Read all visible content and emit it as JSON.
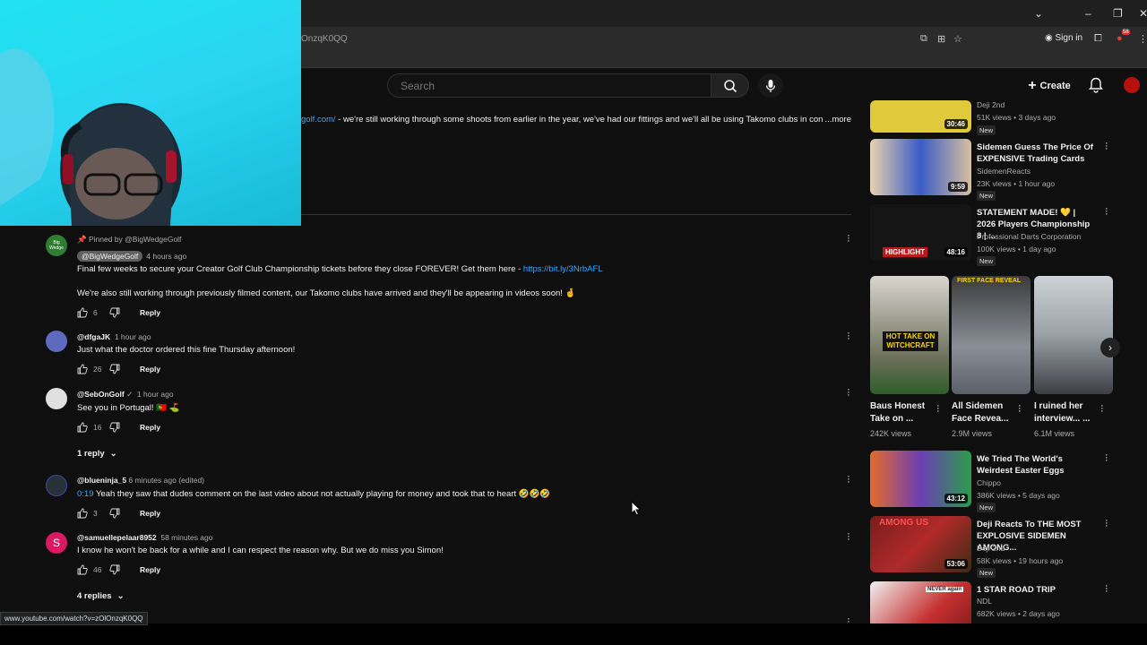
{
  "browser": {
    "url_fragment": "OnzqK0QQ",
    "sign_in": "Sign in",
    "extension_badge": "58"
  },
  "header": {
    "search_placeholder": "Search",
    "create_label": "Create"
  },
  "description": {
    "link": "golf.com/",
    "text": " - we're still working through some shoots from earlier in the year, we've had our fittings and we'll all be using Takomo clubs in con",
    "more": "...more"
  },
  "comments": [
    {
      "pinned": "Pinned by @BigWedgeGolf",
      "author": "@BigWedgeGolf",
      "time": "4 hours ago",
      "avatar_color": "#2e7d32",
      "avatar_letter": "Big Wedge",
      "line1": "Final few weeks to secure your Creator Golf Club Championship tickets before they close FOREVER! Get them here - ",
      "line1_link": "https://bit.ly/3NrbAFL",
      "line2": "We're also still working through previously filmed content, our Takomo clubs have arrived and they'll be appearing in videos soon! 🤞",
      "likes": "6",
      "reply": "Reply"
    },
    {
      "author": "@dfgaJK",
      "time": "1 hour ago",
      "avatar_color": "#3949ab",
      "text": "Just what the doctor ordered this fine Thursday afternoon!",
      "likes": "26",
      "reply": "Reply"
    },
    {
      "author": "@SebOnGolf",
      "verified": "✓",
      "time": "1 hour ago",
      "avatar_color": "#5d4037",
      "text": "See you in Portugal! 🇵🇹 ⛳",
      "likes": "16",
      "reply": "Reply",
      "replies": "1 reply"
    },
    {
      "author": "@blueninja_5",
      "time": "6 minutes ago (edited)",
      "avatar_color": "#263238",
      "timestamp_link": "0:19",
      "text": " Yeah they saw that dudes comment on the last video about not actually playing for money and took that to heart 🤣🤣🤣",
      "likes": "3",
      "reply": "Reply"
    },
    {
      "author": "@samuellepelaar8952",
      "time": "58 minutes ago",
      "avatar_color": "#d81b60",
      "avatar_letter": "S",
      "text": "I know he won't be back for a while and I can respect the reason why. But we do miss you Simon!",
      "likes": "46",
      "reply": "Reply",
      "replies": "4 replies"
    }
  ],
  "sidebar": {
    "videos_top": [
      {
        "title": "",
        "channel": "Deji 2nd",
        "views": "51K views • 3 days ago",
        "badge": "New",
        "duration": "30:46",
        "thumb_color": "#e0c93a"
      },
      {
        "title": "Sidemen Guess The Price Of EXPENSIVE Trading Cards",
        "channel": "SidemenReacts",
        "views": "23K views • 1 hour ago",
        "badge": "New",
        "duration": "9:59",
        "thumb_color": "#3a5bc7"
      },
      {
        "title": "STATEMENT MADE! 💛 | 2026 Players Championship 8 | ...",
        "channel": "Professional Darts Corporation",
        "views": "100K views • 1 day ago",
        "badge": "New",
        "duration": "48:16",
        "thumb_color": "#1c1c1c",
        "thumb_label": "HIGHLIGHT"
      }
    ],
    "shorts": [
      {
        "title": "Baus Honest Take on ...",
        "views": "242K views",
        "overlay": "HOT TAKE ON WITCHCRAFT",
        "bg": "#6b6f5a"
      },
      {
        "title": "All Sidemen Face Revea...",
        "views": "2.9M views",
        "overlay": "FIRST FACE REVEAL",
        "bg": "#8a8f97"
      },
      {
        "title": "I ruined her interview... ...",
        "views": "6.1M views",
        "overlay": "",
        "bg": "#9aa0a6"
      }
    ],
    "videos_bottom": [
      {
        "title": "We Tried The World's Weirdest Easter Eggs",
        "channel": "Chippo",
        "views": "386K views • 5 days ago",
        "badge": "New",
        "duration": "43:12",
        "thumb_color": "#6a3fb5"
      },
      {
        "title": "Deji Reacts To THE MOST EXPLOSIVE SIDEMEN AMONG...",
        "channel": "Deji 2nd",
        "views": "58K views • 19 hours ago",
        "badge": "New",
        "duration": "53:06",
        "thumb_color": "#b02a2a",
        "thumb_label": "AMONG US"
      },
      {
        "title": "1 STAR ROAD TRIP",
        "channel": "NDL",
        "views": "682K views • 2 days ago",
        "badge": "",
        "duration": "",
        "thumb_color": "#c43030",
        "thumb_label": "NEVER again"
      }
    ]
  },
  "status_url": "www.youtube.com/watch?v=zOlOnzqK0QQ"
}
